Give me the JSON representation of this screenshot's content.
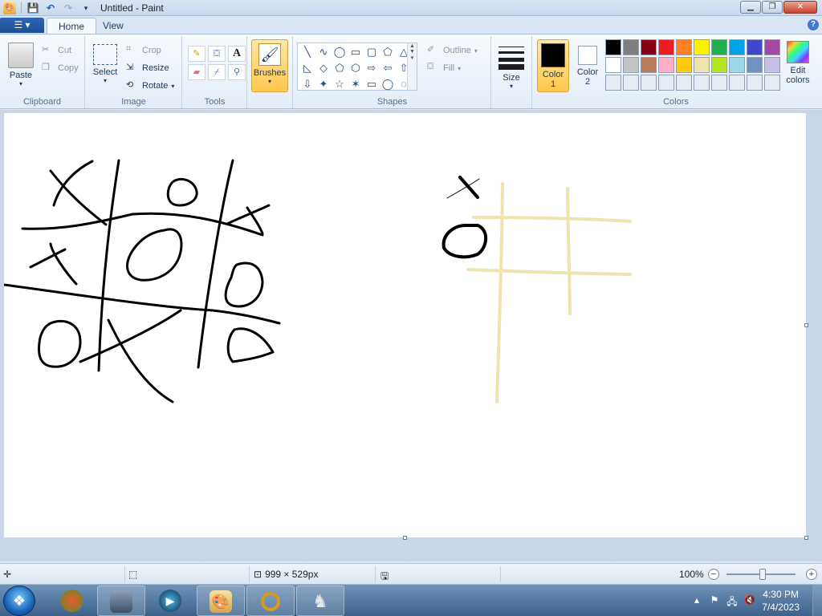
{
  "titlebar": {
    "title": "Untitled - Paint",
    "qat_icons": [
      "save-icon",
      "undo-icon",
      "redo-icon",
      "customize-icon"
    ]
  },
  "tabs": {
    "app_menu_icon": "app-menu-icon",
    "home": "Home",
    "view": "View"
  },
  "ribbon": {
    "clipboard": {
      "label": "Clipboard",
      "paste": "Paste",
      "cut": "Cut",
      "copy": "Copy"
    },
    "image": {
      "label": "Image",
      "select": "Select",
      "crop": "Crop",
      "resize": "Resize",
      "rotate": "Rotate"
    },
    "tools": {
      "label": "Tools",
      "items": [
        "pencil-icon",
        "fill-icon",
        "text-icon",
        "eraser-icon",
        "color-picker-icon",
        "magnifier-icon"
      ]
    },
    "brushes": {
      "label": "Brushes"
    },
    "shapes": {
      "label": "Shapes",
      "outline": "Outline",
      "fill": "Fill",
      "glyphs": [
        "╲",
        "∿",
        "◯",
        "▭",
        "▢",
        "⬠",
        "△",
        "◺",
        "◇",
        "⬠",
        "⬡",
        "⇨",
        "⇦",
        "⇧",
        "⇩",
        "✦",
        "☆",
        "✶",
        "▭",
        "◯",
        "◌"
      ]
    },
    "size": {
      "label": "Size"
    },
    "colors": {
      "label": "Colors",
      "color1": "Color 1",
      "color2": "Color 2",
      "color1_value": "#000000",
      "color2_value": "#ffffff",
      "edit": "Edit colors",
      "palette": [
        "#000000",
        "#7f7f7f",
        "#880015",
        "#ed1c24",
        "#ff7f27",
        "#fff200",
        "#22b14c",
        "#00a2e8",
        "#3f48cc",
        "#a349a4",
        "#ffffff",
        "#c3c3c3",
        "#b97a57",
        "#ffaec9",
        "#ffc90e",
        "#efe4b0",
        "#b5e61d",
        "#99d9ea",
        "#7092be",
        "#c8bfe7",
        "#e6ecf4",
        "#e6ecf4",
        "#e6ecf4",
        "#e6ecf4",
        "#e6ecf4",
        "#e6ecf4",
        "#e6ecf4",
        "#e6ecf4",
        "#e6ecf4",
        "#e6ecf4"
      ]
    }
  },
  "drawing": {
    "ink_color": "#000000",
    "grid_color": "#efe4b0"
  },
  "statusbar": {
    "image_size": "999 × 529px",
    "zoom": "100%",
    "zoom_level": 1.0
  },
  "taskbar": {
    "pinned_icons": [
      "media-center-icon",
      "camera-app-icon",
      "media-player-icon",
      "paint-app-icon",
      "ring-app-icon",
      "chess-app-icon"
    ],
    "time": "4:30 PM",
    "date": "7/4/2023",
    "tray_icons": [
      "show-hidden-icons-icon",
      "action-center-icon",
      "network-icon",
      "volume-muted-icon"
    ]
  }
}
